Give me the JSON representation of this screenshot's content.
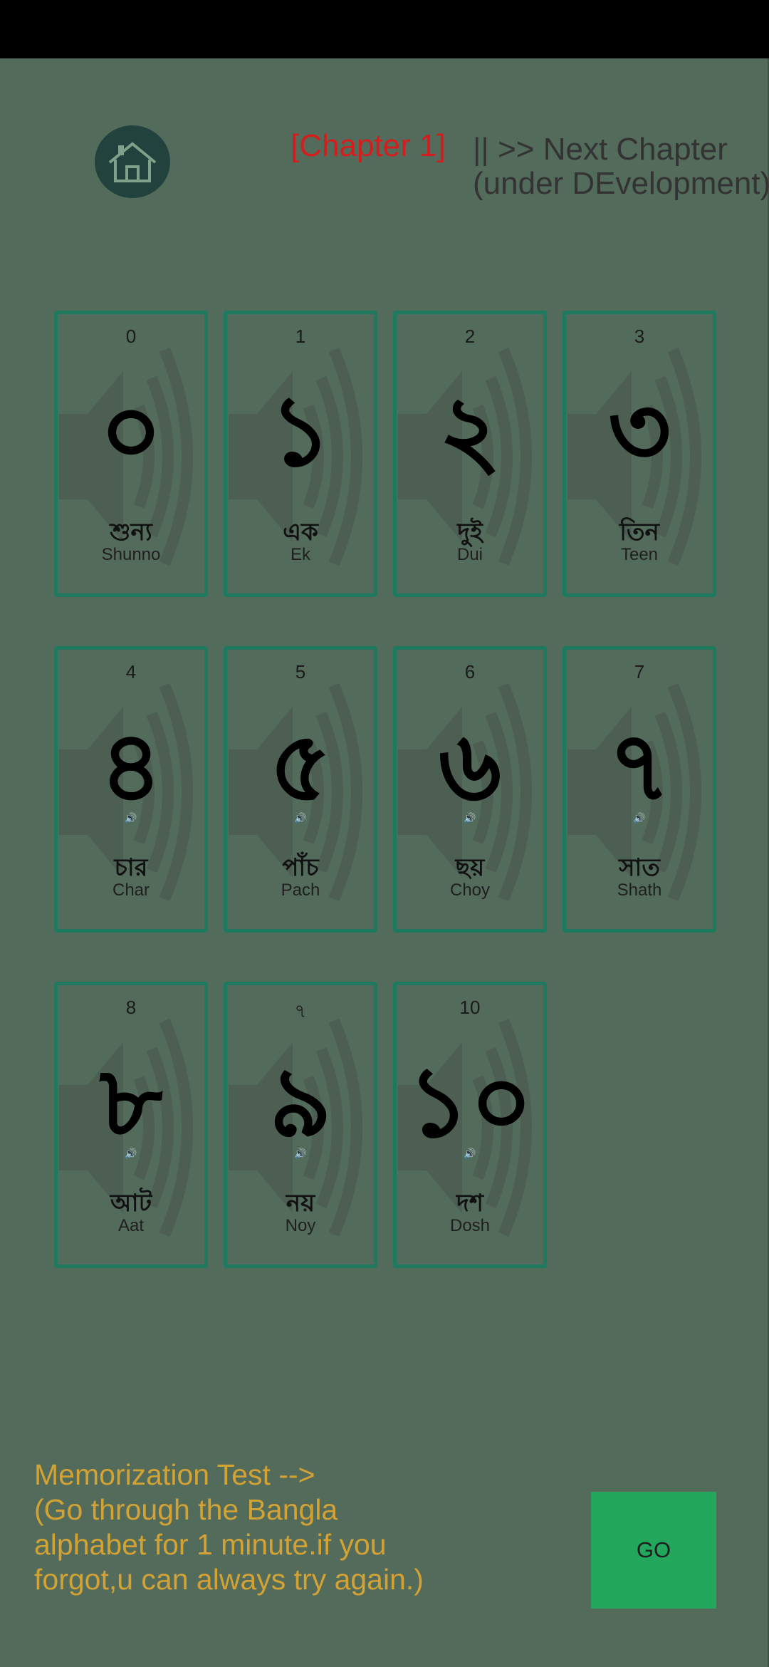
{
  "header": {
    "chapter_label": "[Chapter 1]",
    "next_chapter_text": "|| >> Next Chapter\n(under DEvelopment)"
  },
  "icons": {
    "home": "home-icon",
    "card_background": "speaker-sound-icon",
    "card_small": "small-speaker-icon"
  },
  "colors": {
    "background": "#536b5b",
    "card_border": "#1e7a5e",
    "chapter": "#d41e1e",
    "memo_text": "#d2a235",
    "go_button": "#22a75c",
    "home_button": "#21423d"
  },
  "cards": [
    {
      "number": "0",
      "glyph": "০",
      "bangla": "শুন্য",
      "roman": "Shunno",
      "has_speaker": false
    },
    {
      "number": "1",
      "glyph": "১",
      "bangla": "এক",
      "roman": "Ek",
      "has_speaker": false
    },
    {
      "number": "2",
      "glyph": "২",
      "bangla": "দুই",
      "roman": "Dui",
      "has_speaker": false
    },
    {
      "number": "3",
      "glyph": "৩",
      "bangla": "তিন",
      "roman": "Teen",
      "has_speaker": false
    },
    {
      "number": "4",
      "glyph": "৪",
      "bangla": "চার",
      "roman": "Char",
      "has_speaker": true
    },
    {
      "number": "5",
      "glyph": "৫",
      "bangla": "পাঁচ",
      "roman": "Pach",
      "has_speaker": true
    },
    {
      "number": "6",
      "glyph": "৬",
      "bangla": "ছয়",
      "roman": "Choy",
      "has_speaker": true
    },
    {
      "number": "7",
      "glyph": "৭",
      "bangla": "সাত",
      "roman": "Shath",
      "has_speaker": true
    },
    {
      "number": "8",
      "glyph": "৮",
      "bangla": "আট",
      "roman": "Aat",
      "has_speaker": true
    },
    {
      "number": "৭",
      "glyph": "৯",
      "bangla": "নয়",
      "roman": "Noy",
      "has_speaker": true
    },
    {
      "number": "10",
      "glyph": "১০",
      "bangla": "দশ",
      "roman": "Dosh",
      "has_speaker": true
    }
  ],
  "memo": {
    "text": "Memorization Test -->\n(Go through the Bangla\nalphabet for 1 minute.if you\nforgot,u can always try again.)"
  },
  "go_button": {
    "label": "GO"
  }
}
